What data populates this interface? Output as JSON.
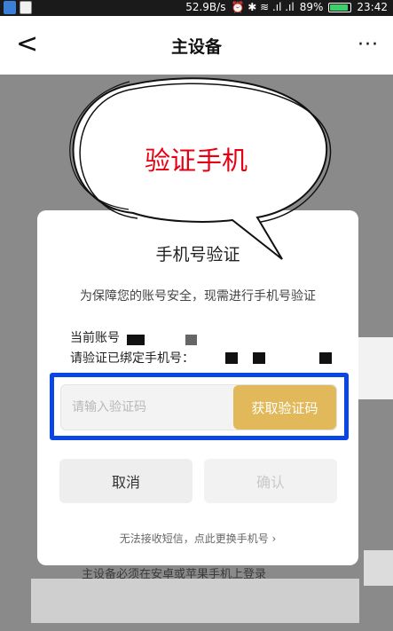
{
  "status_bar": {
    "speed": "52.9B/s",
    "signal_glyphs": "⏰ ✱ ≋ .ıl .ıl",
    "battery_text": "89%",
    "battery_level": 0.89,
    "time": "23:42",
    "battery_color": "#3ad16a"
  },
  "nav": {
    "back_icon": "chevron-left-icon",
    "back_glyph": "<",
    "title": "主设备",
    "more_glyph": "···"
  },
  "annotation": {
    "text": "验证手机",
    "color": "#e60012"
  },
  "dialog": {
    "title": "手机号验证",
    "description": "为保障您的账号安全，现需进行手机号验证",
    "account_label": "当前账号",
    "verify_label": "请验证已绑定手机号：",
    "code_input": {
      "value": "",
      "placeholder": "请输入验证码"
    },
    "get_code_label": "获取验证码",
    "cancel_label": "取消",
    "confirm_label": "确认",
    "change_phone_label": "无法接收短信，点此更换手机号 ›",
    "highlight_color": "#0a45e6",
    "accent_color": "#e1b95a"
  },
  "background": {
    "footnote": "主设备必须在安卓或苹果手机上登录"
  }
}
